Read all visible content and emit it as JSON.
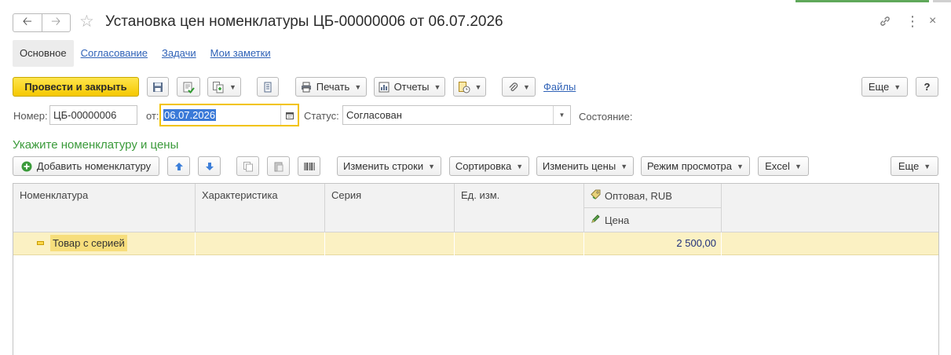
{
  "window": {
    "title": "Установка цен номенклатуры ЦБ-00000006 от 06.07.2026",
    "back_icon": "arrow-left",
    "forward_icon": "arrow-right",
    "favorite_icon": "star"
  },
  "tabs": [
    {
      "label": "Основное",
      "active": true
    },
    {
      "label": "Согласование",
      "active": false
    },
    {
      "label": "Задачи",
      "active": false
    },
    {
      "label": "Мои заметки",
      "active": false
    }
  ],
  "toolbar": {
    "post_close": "Провести и закрыть",
    "print": "Печать",
    "reports": "Отчеты",
    "files": "Файлы",
    "more": "Еще",
    "help": "?"
  },
  "form": {
    "number_label": "Номер:",
    "number_value": "ЦБ-00000006",
    "date_label": "от:",
    "date_value": "06.07.2026",
    "status_label": "Статус:",
    "status_value": "Согласован",
    "state_label": "Состояние:"
  },
  "section": {
    "title": "Укажите номенклатуру и цены"
  },
  "table_toolbar": {
    "add": "Добавить номенклатуру",
    "change_rows": "Изменить строки",
    "sort": "Сортировка",
    "change_prices": "Изменить цены",
    "view_mode": "Режим просмотра",
    "excel": "Excel",
    "more": "Еще"
  },
  "table": {
    "headers": {
      "nomenclature": "Номенклатура",
      "characteristic": "Характеристика",
      "series": "Серия",
      "unit": "Ед. изм.",
      "price_type": "Оптовая, RUB",
      "price": "Цена"
    },
    "rows": [
      {
        "nomenclature": "Товар с серией",
        "characteristic": "",
        "series": "",
        "unit": "",
        "price": "2 500,00"
      }
    ]
  },
  "colors": {
    "primary_button": "#f5c800",
    "link": "#2f62b7",
    "section_title": "#3a9a3a",
    "row_highlight": "#fbf1c3"
  }
}
